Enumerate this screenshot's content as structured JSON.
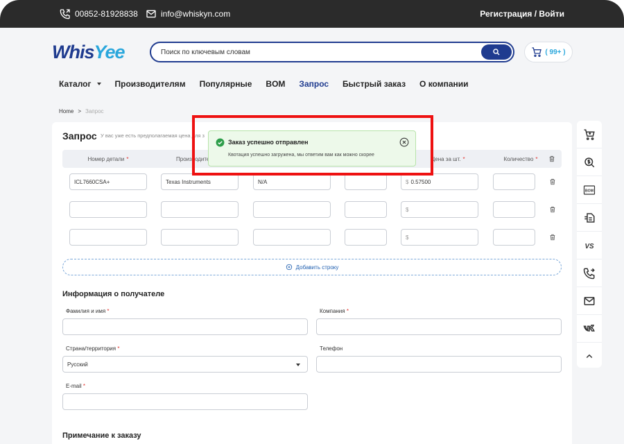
{
  "topbar": {
    "phone": "00852-81928838",
    "email": "info@whiskyn.com",
    "auth": "Регистрация / Войти"
  },
  "header": {
    "logo_left": "Whis",
    "logo_right": "Yee",
    "search_placeholder": "Поиск по ключевым словам",
    "cart_count": "( 99+ )"
  },
  "nav": {
    "items": [
      {
        "label": "Каталог"
      },
      {
        "label": "Производителям"
      },
      {
        "label": "Популярные"
      },
      {
        "label": "BOM"
      },
      {
        "label": "Запрос"
      },
      {
        "label": "Быстрый заказ"
      },
      {
        "label": "О компании"
      }
    ],
    "active": "Запрос"
  },
  "breadcrumb": {
    "home": "Home",
    "separator": ">",
    "current": "Запрос"
  },
  "card": {
    "title": "Запрос",
    "subtitle": "У вас уже есть предполагаемая цена для з"
  },
  "table": {
    "headers": {
      "part": "Номер детали",
      "manufacturer": "Производите",
      "price": "Цена за шт.",
      "qty": "Количество"
    },
    "required_mark": "*",
    "rows": [
      {
        "part": "ICL7660CSA+",
        "manufacturer": "Texas Instruments",
        "package": "N/A",
        "date": "",
        "price_symbol": "$",
        "price": "0.57500",
        "qty": ""
      },
      {
        "part": "",
        "manufacturer": "",
        "package": "",
        "date": "",
        "price_symbol": "$",
        "price": "",
        "qty": ""
      },
      {
        "part": "",
        "manufacturer": "",
        "package": "",
        "date": "",
        "price_symbol": "$",
        "price": "",
        "qty": ""
      }
    ],
    "add_row": "Добавить строку"
  },
  "recipient": {
    "title": "Информация о получателе",
    "name_label": "Фамилия и имя",
    "company_label": "Компания",
    "country_label": "Страна/территория",
    "country_value": "Русский",
    "phone_label": "Телефон",
    "email_label": "E-mail"
  },
  "note": {
    "title": "Примечание к заказу"
  },
  "toast": {
    "title": "Заказ успешно отправлен",
    "message": "Квотация успешно загружена, мы ответим вам как можно скорее"
  },
  "sidebar_icons": [
    "cart-icon",
    "dollar-search-icon",
    "bom-icon",
    "quick-order-icon",
    "vs-icon",
    "phone-forward-icon",
    "mail-icon",
    "vk-icon",
    "chevron-up-icon"
  ],
  "colors": {
    "brand_dark": "#1f3b8f",
    "brand_light": "#2aa7dc",
    "required": "#e3342f",
    "toast_bg": "#edf9ea",
    "highlight": "#ee1111"
  }
}
